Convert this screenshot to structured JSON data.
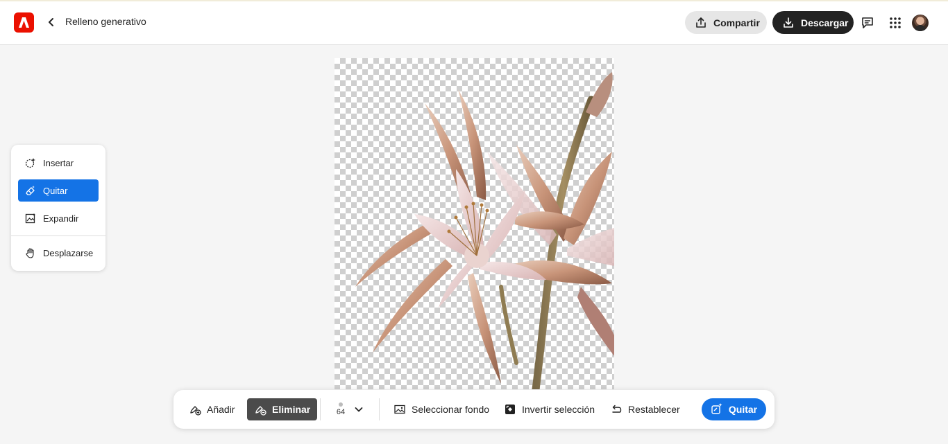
{
  "header": {
    "title": "Relleno generativo",
    "share_label": "Compartir",
    "download_label": "Descargar"
  },
  "tools": {
    "items": [
      {
        "label": "Insertar",
        "icon": "generative-insert-icon"
      },
      {
        "label": "Quitar",
        "icon": "remove-icon",
        "active": true
      },
      {
        "label": "Expandir",
        "icon": "expand-icon"
      },
      {
        "label": "Desplazarse",
        "icon": "hand-icon"
      }
    ]
  },
  "toolbar": {
    "add_label": "Añadir",
    "erase_label": "Eliminar",
    "brush_size": "64",
    "select_bg_label": "Seleccionar fondo",
    "invert_label": "Invertir selección",
    "reset_label": "Restablecer",
    "primary_label": "Quitar"
  },
  "colors": {
    "accent": "#1473e6",
    "adobe_red": "#eb1000",
    "dark_button": "#222222"
  }
}
